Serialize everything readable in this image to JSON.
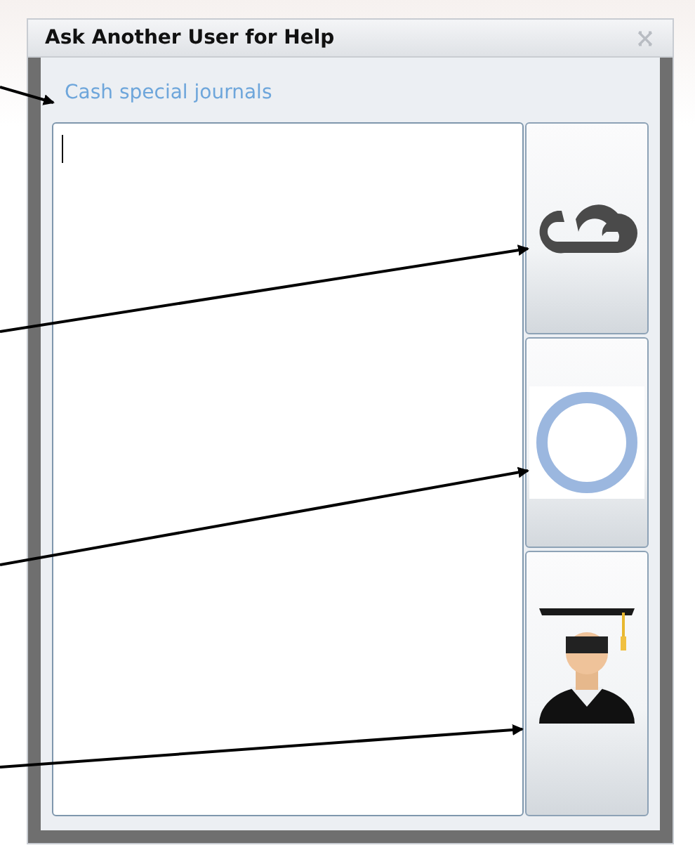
{
  "window": {
    "title": "Ask Another User for Help"
  },
  "link": {
    "label": "Cash special journals"
  },
  "message_field": {
    "focused": true
  },
  "side_buttons": [
    {
      "kind": "cloud"
    },
    {
      "kind": "ring"
    },
    {
      "kind": "graduate"
    }
  ]
}
